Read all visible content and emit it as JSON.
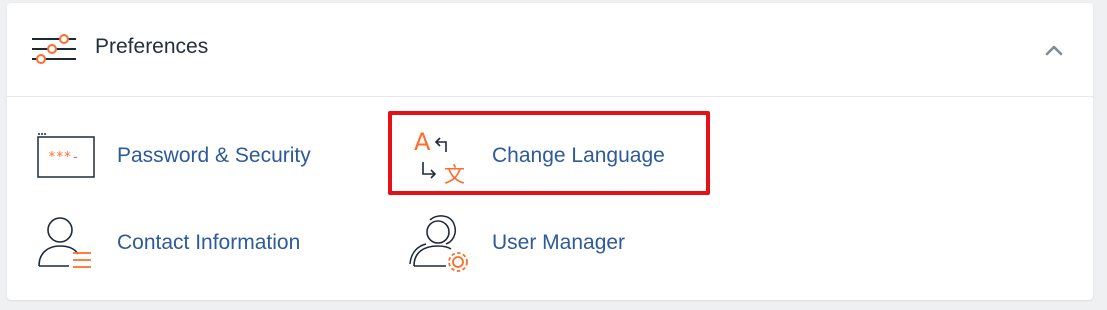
{
  "section": {
    "title": "Preferences",
    "header_icon": "sliders-icon",
    "collapse_icon": "chevron-up-icon"
  },
  "items": [
    {
      "label": "Password & Security",
      "icon": "password-field-icon"
    },
    {
      "label": "Change Language",
      "icon": "translate-icon"
    },
    {
      "label": "Contact Information",
      "icon": "user-contact-icon"
    },
    {
      "label": "User Manager",
      "icon": "users-gear-icon"
    }
  ],
  "icon_text": {
    "password_mask": "***-",
    "lang_latin": "A",
    "lang_cjk": "文"
  },
  "colors": {
    "accent_orange": "#ff6c2c",
    "link_blue": "#2d5a99",
    "highlight_red": "#e41117"
  }
}
